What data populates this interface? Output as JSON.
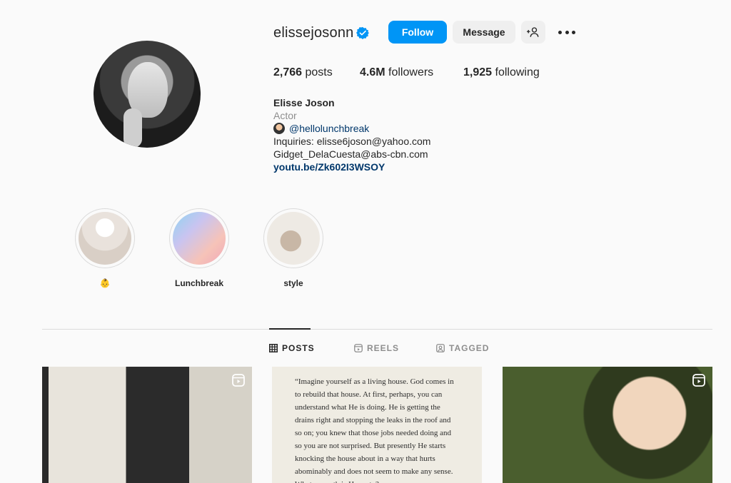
{
  "profile": {
    "username": "elissejosonn",
    "verified": true,
    "follow_label": "Follow",
    "message_label": "Message",
    "suggest_icon": "add-person-icon",
    "stats": {
      "posts_count": "2,766",
      "posts_label": "posts",
      "followers_count": "4.6M",
      "followers_label": "followers",
      "following_count": "1,925",
      "following_label": "following"
    },
    "bio": {
      "name": "Elisse Joson",
      "category": "Actor",
      "mention": "@hellolunchbreak",
      "line1": "Inquiries: elisse6joson@yahoo.com",
      "line2": "Gidget_DelaCuesta@abs-cbn.com",
      "link": "youtu.be/Zk602I3WSOY"
    }
  },
  "highlights": [
    {
      "label": "👶"
    },
    {
      "label": "Lunchbreak"
    },
    {
      "label": "style"
    }
  ],
  "tabs": [
    {
      "label": "POSTS",
      "active": true
    },
    {
      "label": "REELS",
      "active": false
    },
    {
      "label": "TAGGED",
      "active": false
    }
  ],
  "posts": [
    {
      "type": "reel"
    },
    {
      "type": "image",
      "text": "“Imagine yourself as a living house. God comes in to rebuild that house. At first, perhaps, you can understand what He is doing. He is getting the drains right and stopping the leaks in the roof and so on; you knew that those jobs needed doing and so you are not surprised. But presently He starts knocking the house about in a way that hurts abominably and does not seem to make any sense. What on earth is He up to?"
    },
    {
      "type": "reel"
    }
  ],
  "colors": {
    "accent": "#0095f6",
    "verified": "#0095f6",
    "link": "#00376b"
  }
}
